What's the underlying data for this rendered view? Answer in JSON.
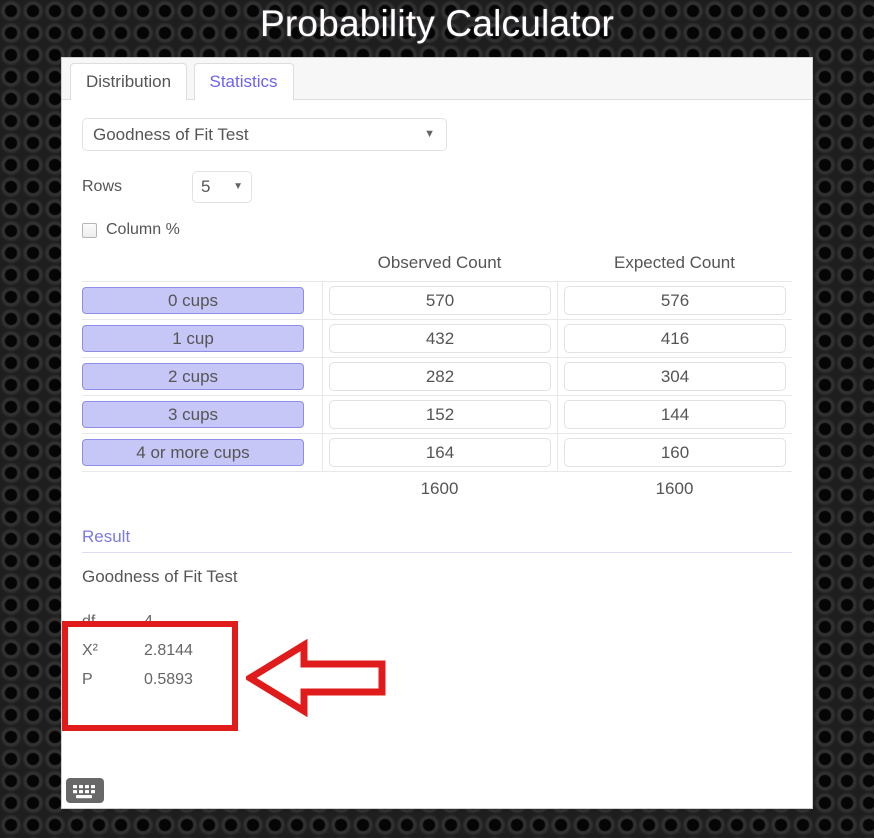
{
  "page": {
    "title": "Probability Calculator"
  },
  "tabs": [
    {
      "label": "Distribution",
      "active": false
    },
    {
      "label": "Statistics",
      "active": true
    }
  ],
  "controls": {
    "test_select": {
      "value": "Goodness of Fit Test",
      "caret": "chevron-down-icon"
    },
    "rows": {
      "label": "Rows",
      "value": "5",
      "caret": "chevron-down-icon"
    },
    "column_pct": {
      "label": "Column %",
      "checked": false
    }
  },
  "table": {
    "headers": {
      "row_label": "",
      "observed": "Observed Count",
      "expected": "Expected Count"
    },
    "rows": [
      {
        "label": "0 cups",
        "observed": "570",
        "expected": "576"
      },
      {
        "label": "1 cup",
        "observed": "432",
        "expected": "416"
      },
      {
        "label": "2 cups",
        "observed": "282",
        "expected": "304"
      },
      {
        "label": "3 cups",
        "observed": "152",
        "expected": "144"
      },
      {
        "label": "4 or more cups",
        "observed": "164",
        "expected": "160"
      }
    ],
    "totals": {
      "observed": "1600",
      "expected": "1600"
    }
  },
  "result": {
    "heading": "Result",
    "subtitle": "Goodness of Fit Test",
    "stats": [
      {
        "key": "df",
        "value": "4"
      },
      {
        "key": "X²",
        "value": "2.8144"
      },
      {
        "key": "P",
        "value": "0.5893"
      }
    ]
  },
  "footer": {
    "keyboard_icon": "keyboard-icon"
  },
  "annotations": {
    "highlight_color": "#e01b1b",
    "arrow_icon": "left-arrow-annotation"
  },
  "colors": {
    "accent": "#6c63f0",
    "row_button_fill": "#c7c7f7",
    "row_button_border": "#8e8ee8",
    "result_heading": "#7b7be0",
    "annotation_red": "#e01b1b"
  }
}
